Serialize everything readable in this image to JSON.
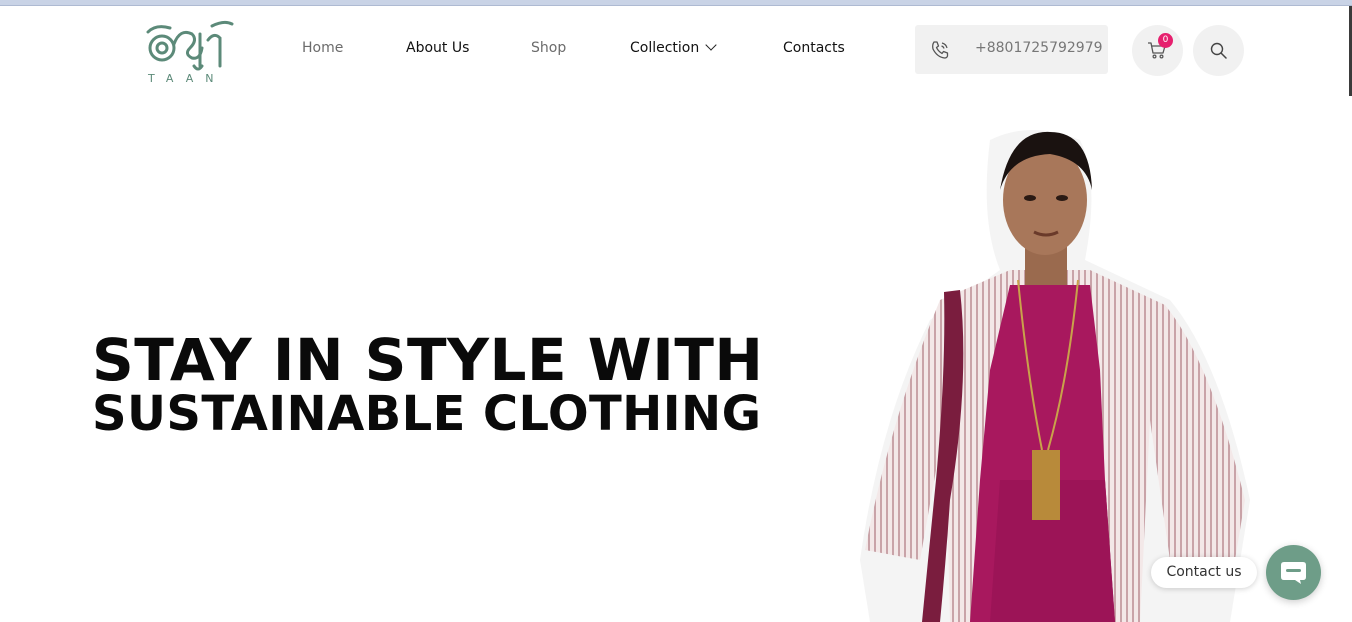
{
  "brand": {
    "logo_text": "TAAN",
    "logo_color": "#5c8a79",
    "logo_icon": "taan-logo-icon"
  },
  "nav": {
    "items": [
      {
        "label": "Home"
      },
      {
        "label": "About Us"
      },
      {
        "label": "Shop"
      },
      {
        "label": "Collection"
      },
      {
        "label": "Contacts"
      }
    ]
  },
  "header": {
    "phone": "+8801725792979",
    "phone_icon": "phone-icon",
    "cart_count": "0",
    "cart_icon": "cart-icon",
    "search_icon": "search-icon",
    "badge_color": "#e6206e"
  },
  "hero": {
    "line1": "STAY IN STYLE WITH",
    "line2": "SUSTAINABLE CLOTHING",
    "image": "model-in-magenta-dress-and-striped-jacket"
  },
  "contact": {
    "label": "Contact us",
    "fab_color": "#6e9d88",
    "icon": "chat-icon"
  }
}
